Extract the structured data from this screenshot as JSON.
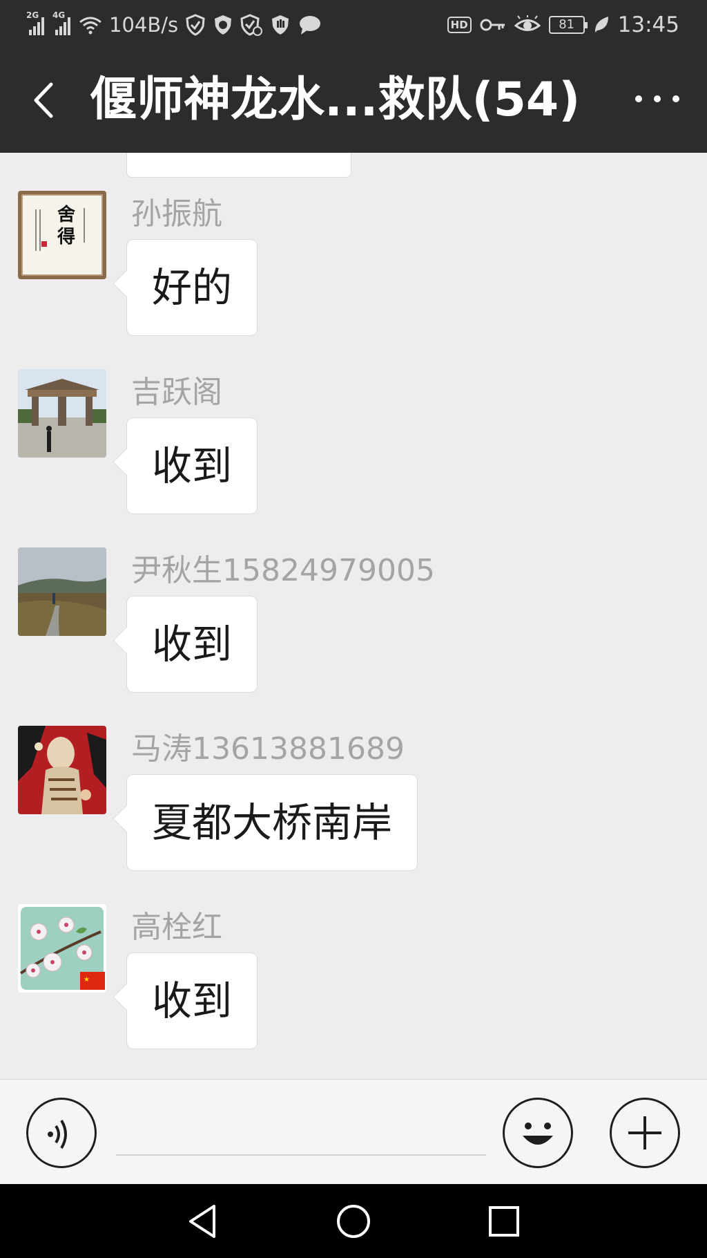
{
  "status_bar": {
    "signal_1": "2G",
    "signal_2": "4G",
    "speed": "104B/s",
    "hd": "HD",
    "battery": "81",
    "time": "13:45",
    "icons": [
      "signal-icon",
      "signal-icon",
      "wifi-icon",
      "shield-icon",
      "virus-scan-icon",
      "shield-alert-icon",
      "hand-icon",
      "chat-icon",
      "hd-icon",
      "key-icon",
      "eye-icon",
      "battery-icon",
      "leaf-icon"
    ]
  },
  "header": {
    "title": "偃师神龙水...救队(54)",
    "icons": [
      "back-arrow-icon",
      "more-icon"
    ]
  },
  "messages": [
    {
      "sender": "孙振航",
      "text": "好的",
      "avatar": "calligraphy-avatar"
    },
    {
      "sender": "吉跃阁",
      "text": "收到",
      "avatar": "gate-photo-avatar"
    },
    {
      "sender": "尹秋生15824979005",
      "text": "收到",
      "avatar": "landscape-avatar"
    },
    {
      "sender": "马涛13613881689",
      "text": "夏都大桥南岸",
      "avatar": "painting-avatar"
    },
    {
      "sender": "高栓红",
      "text": "收到",
      "avatar": "blossom-avatar"
    }
  ],
  "avatar_texts": {
    "calligraphy": "舍得"
  },
  "input_bar": {
    "value": "",
    "icons": [
      "voice-icon",
      "emoji-icon",
      "plus-icon"
    ]
  },
  "nav": {
    "icons": [
      "back-triangle-icon",
      "home-circle-icon",
      "recents-square-icon"
    ]
  },
  "colors": {
    "header_bg": "#2c2c2c",
    "chat_bg": "#ededed",
    "bubble": "#ffffff",
    "sender_text": "#a4a4a4"
  }
}
